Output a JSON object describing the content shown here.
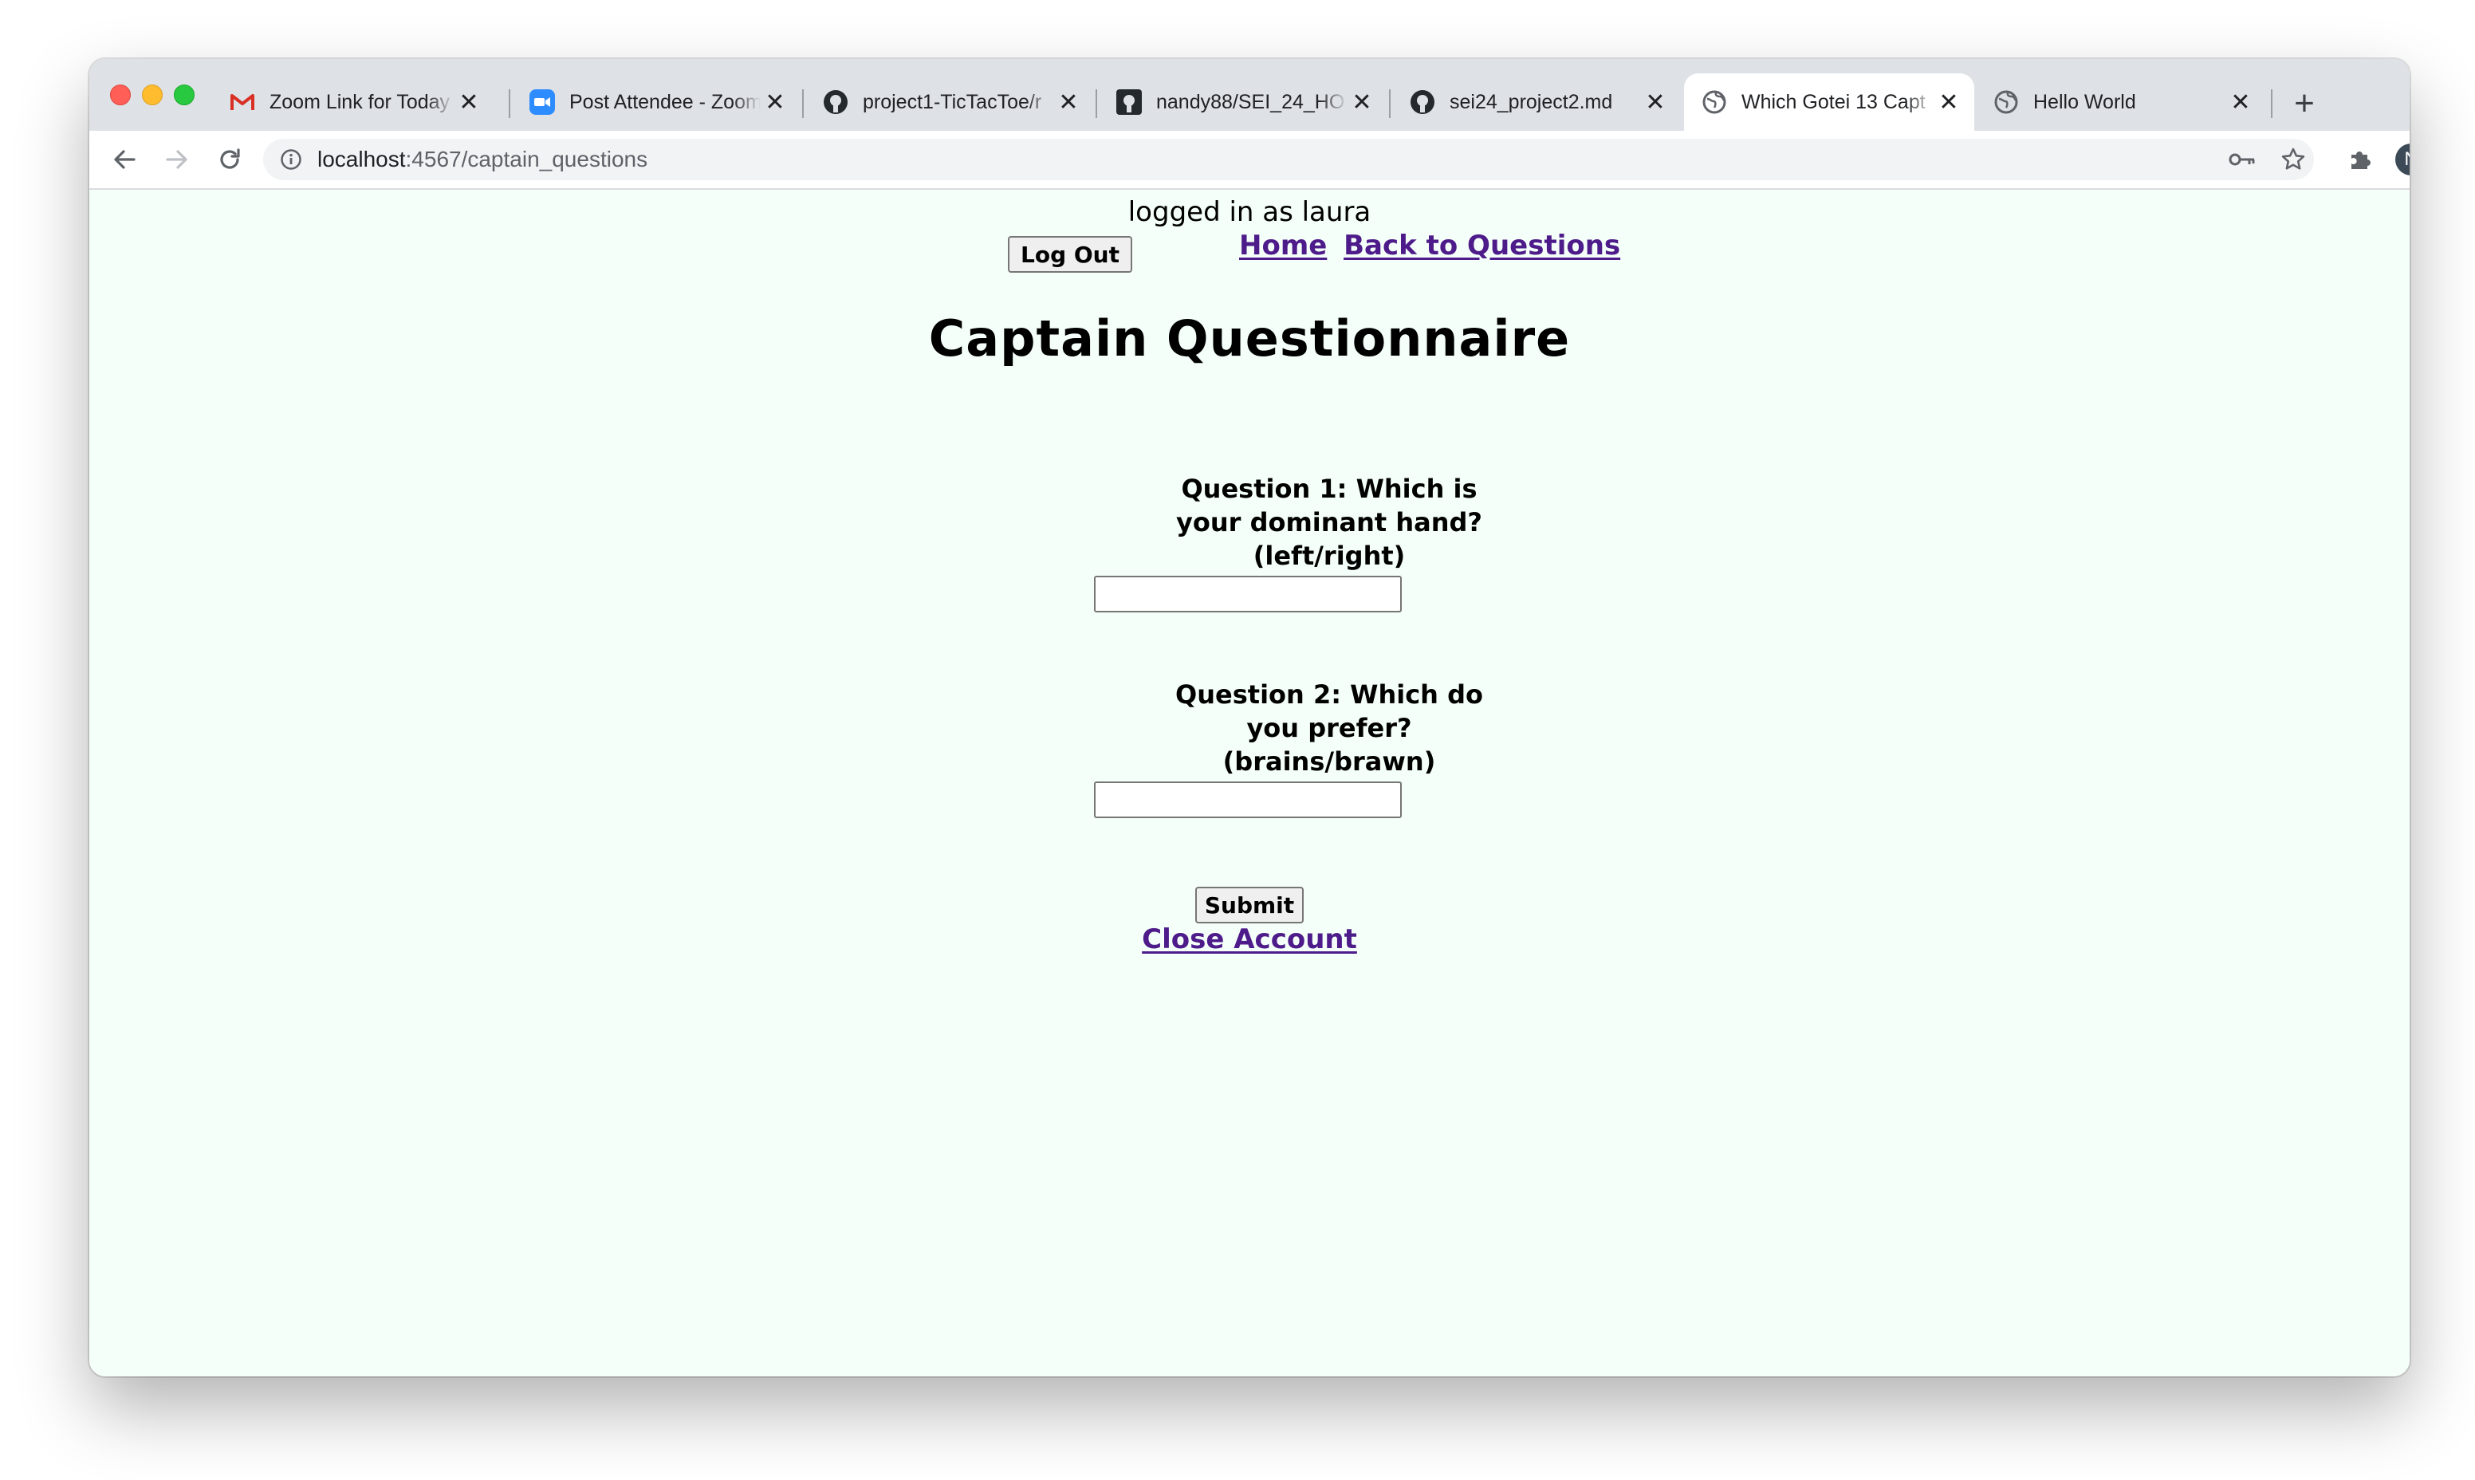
{
  "browser": {
    "tabs": [
      {
        "title": "Zoom Link for Today",
        "icon": "gmail-icon",
        "active": false
      },
      {
        "title": "Post Attendee - Zoom",
        "icon": "zoom-icon",
        "active": false
      },
      {
        "title": "project1-TicTacToe/r",
        "icon": "github-icon",
        "active": false
      },
      {
        "title": "nandy88/SEI_24_HO",
        "icon": "github-icon",
        "active": false
      },
      {
        "title": "sei24_project2.md",
        "icon": "github-icon",
        "active": false
      },
      {
        "title": "Which Gotei 13 Capt",
        "icon": "globe-icon",
        "active": true
      },
      {
        "title": "Hello World",
        "icon": "globe-icon",
        "active": false
      }
    ],
    "new_tab_label": "+",
    "close_glyph": "✕",
    "url_host": "localhost",
    "url_rest": ":4567/captain_questions",
    "profile_initial": "N",
    "colors": {
      "link": "#4d1b8a",
      "page_background": "#f5fff9",
      "tab_strip": "#dee1e6"
    }
  },
  "page": {
    "logged_in_text": "logged in as laura",
    "logout_label": "Log Out",
    "nav_links": {
      "home": "Home",
      "back": "Back to Questions"
    },
    "title": "Captain Questionnaire",
    "questions": [
      {
        "label": "Question 1: Which is your dominant hand? (left/right)",
        "value": ""
      },
      {
        "label": "Question 2: Which do you prefer? (brains/brawn)",
        "value": ""
      }
    ],
    "submit_label": "Submit",
    "close_account_label": "Close Account"
  }
}
